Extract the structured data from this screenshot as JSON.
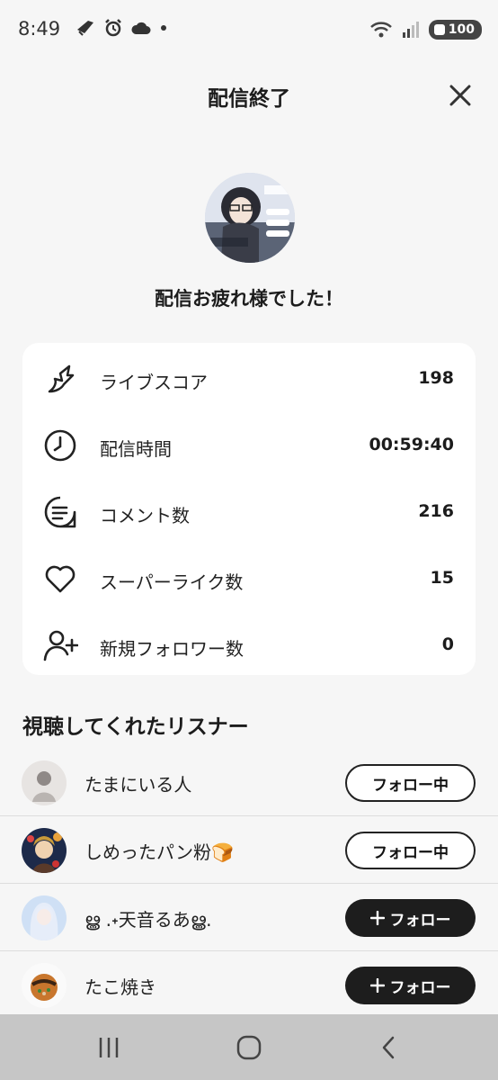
{
  "status_bar": {
    "time": "8:49",
    "battery": "100"
  },
  "header": {
    "title": "配信終了"
  },
  "thanks_message": "配信お疲れ様でした！",
  "stats": [
    {
      "icon": "score-arrow-icon",
      "label": "ライブスコア",
      "value": "198"
    },
    {
      "icon": "clock-icon",
      "label": "配信時間",
      "value": "00:59:40"
    },
    {
      "icon": "comment-icon",
      "label": "コメント数",
      "value": "216"
    },
    {
      "icon": "heart-icon",
      "label": "スーパーライク数",
      "value": "15"
    },
    {
      "icon": "add-user-icon",
      "label": "新規フォロワー数",
      "value": "0"
    }
  ],
  "listeners_section": {
    "title": "視聴してくれたリスナー",
    "listeners": [
      {
        "name": "たまにいる人",
        "button": "フォロー中",
        "following": true
      },
      {
        "name": "しめったパン粉🍞",
        "button": "フォロー中",
        "following": true
      },
      {
        "name": "ൠ .˖天音るあൠ.",
        "button": "フォロー",
        "following": false
      },
      {
        "name": "たこ焼き",
        "button": "フォロー",
        "following": false
      }
    ]
  },
  "colors": {
    "background": "#f6f6f6",
    "card": "#ffffff",
    "button_dark": "#1d1d1d",
    "navbar": "#c6c6c6"
  }
}
